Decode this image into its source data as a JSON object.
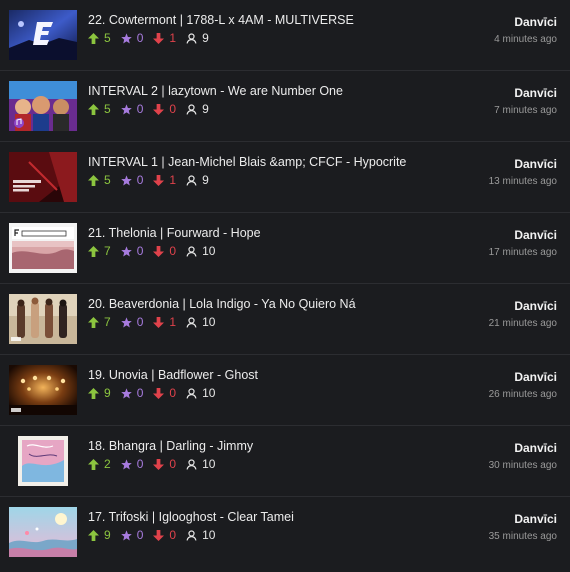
{
  "colors": {
    "background": "#1b1c1f",
    "upvote": "#8cc53f",
    "star": "#a77bde",
    "downvote": "#e0424b",
    "timestamp": "#9a9a9a"
  },
  "icons": {
    "upvote": "arrow-up-icon",
    "star": "star-icon",
    "downvote": "arrow-down-icon",
    "users": "user-icon"
  },
  "items": [
    {
      "title": "22. Cowtermont | 1788-L x 4AM - MULTIVERSE",
      "up": "5",
      "stars": "0",
      "down": "1",
      "users": "9",
      "author": "Danvīci",
      "time": "4 minutes ago"
    },
    {
      "title": "INTERVAL 2 | lazytown - We are Number One",
      "up": "5",
      "stars": "0",
      "down": "0",
      "users": "9",
      "author": "Danvīci",
      "time": "7 minutes ago"
    },
    {
      "title": "INTERVAL 1 | Jean-Michel Blais &amp; CFCF - Hypocrite",
      "up": "5",
      "stars": "0",
      "down": "1",
      "users": "9",
      "author": "Danvīci",
      "time": "13 minutes ago"
    },
    {
      "title": "21. Thelonia | Fourward - Hope",
      "up": "7",
      "stars": "0",
      "down": "0",
      "users": "10",
      "author": "Danvīci",
      "time": "17 minutes ago"
    },
    {
      "title": "20. Beaverdonia | Lola Indigo - Ya No Quiero Ná",
      "up": "7",
      "stars": "0",
      "down": "1",
      "users": "10",
      "author": "Danvīci",
      "time": "21 minutes ago"
    },
    {
      "title": "19. Unovia | Badflower - Ghost",
      "up": "9",
      "stars": "0",
      "down": "0",
      "users": "10",
      "author": "Danvīci",
      "time": "26 minutes ago"
    },
    {
      "title": "18. Bhangra | Darling - Jimmy",
      "up": "2",
      "stars": "0",
      "down": "0",
      "users": "10",
      "author": "Danvīci",
      "time": "30 minutes ago"
    },
    {
      "title": "17. Trifoski | Iglooghost - Clear Tamei",
      "up": "9",
      "stars": "0",
      "down": "0",
      "users": "10",
      "author": "Danvīci",
      "time": "35 minutes ago"
    }
  ]
}
